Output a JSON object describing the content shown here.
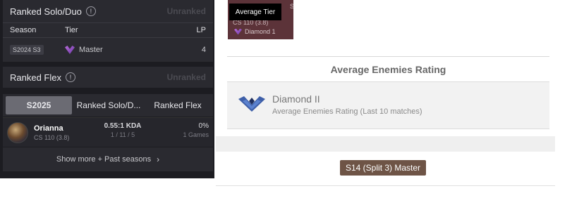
{
  "solo": {
    "title": "Ranked Solo/Duo",
    "status": "Unranked",
    "col_season": "Season",
    "col_tier": "Tier",
    "col_lp": "LP",
    "row": {
      "season": "S2024 S3",
      "tier": "Master",
      "lp": "4"
    }
  },
  "flex": {
    "title": "Ranked Flex",
    "status": "Unranked"
  },
  "tabs": [
    "S2025",
    "Ranked Solo/D...",
    "Ranked Flex"
  ],
  "champion": {
    "name": "Orianna",
    "cs": "CS 110 (3.8)",
    "kda": "0.55:1 KDA",
    "kda_detail": "1 / 11 / 5",
    "winrate": "0%",
    "games": "1 Games"
  },
  "show_more": "Show more + Past seasons",
  "mini_card": {
    "cs": "CS 110 (3.8)",
    "tier": "Diamond 1"
  },
  "tooltip": "Average Tier",
  "average": {
    "heading": "Average Enemies Rating",
    "tier": "Diamond II",
    "subtitle": "Average Enemies Rating (Last 10 matches)"
  },
  "past_badge": "S14 (Split 3) Master"
}
